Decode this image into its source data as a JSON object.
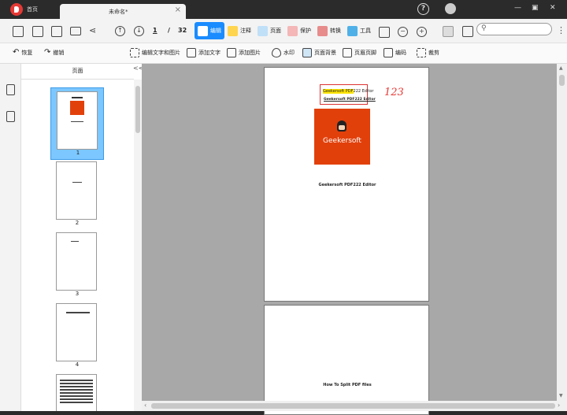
{
  "tabs": {
    "home": "首页",
    "doc": "未命名*"
  },
  "page_nav": {
    "current": "1",
    "sep": "/",
    "total": "32"
  },
  "tools": {
    "edit": "编辑",
    "annotate": "注释",
    "page": "页面",
    "protect": "保护",
    "convert": "转换",
    "tools": "工具"
  },
  "secondary": {
    "undo": "恢复",
    "redo": "撤销",
    "edit_text_image": "编辑文字和图片",
    "add_text": "添加文字",
    "add_image": "添加图片",
    "watermark": "水印",
    "background": "页面背景",
    "header_footer": "页眉页脚",
    "bates": "编码",
    "crop": "裁剪"
  },
  "panel": {
    "title": "页面",
    "collapse": "<<"
  },
  "thumbs": [
    "1",
    "2",
    "3",
    "4"
  ],
  "doc": {
    "box1_hl": "Geekersoft PDF",
    "box1_rest": "222 Editor",
    "box1_line2": "Geekersoft PDF222 Editor",
    "handwriting": "123",
    "logo_text": "Geekersoft",
    "caption": "Geekersoft PDF222 Editor",
    "page2_text": "How To Split PDF files"
  },
  "colors": {
    "accent": "#1a8cff",
    "logo": "#e2400b"
  }
}
